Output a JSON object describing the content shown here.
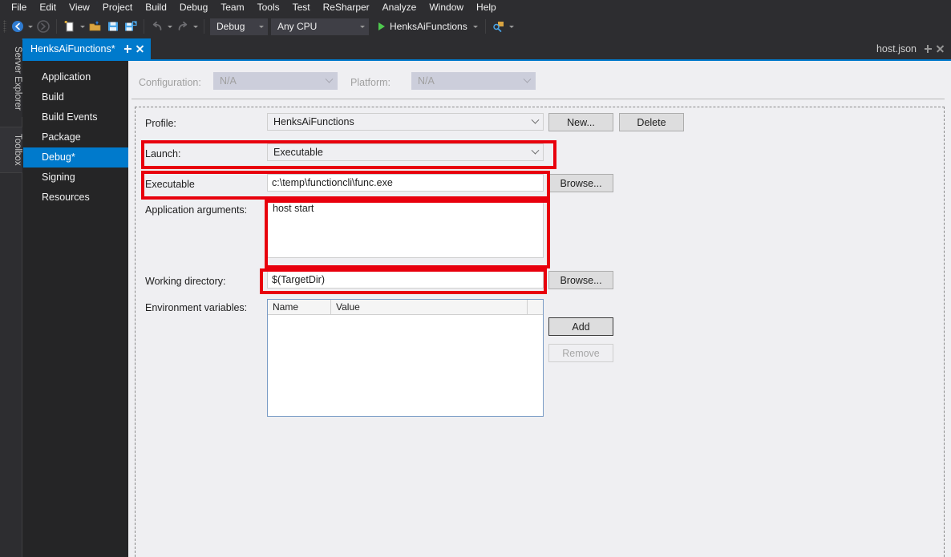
{
  "menubar": {
    "items": [
      "File",
      "Edit",
      "View",
      "Project",
      "Build",
      "Debug",
      "Team",
      "Tools",
      "Test",
      "ReSharper",
      "Analyze",
      "Window",
      "Help"
    ]
  },
  "toolbar": {
    "nav_back_icon": "navigate-back-icon",
    "nav_forward_icon": "navigate-forward-icon",
    "new_item_icon": "new-item-icon",
    "open_file_icon": "open-file-icon",
    "save_icon": "save-icon",
    "save_all_icon": "save-all-icon",
    "undo_icon": "undo-icon",
    "redo_icon": "redo-icon",
    "configuration": "Debug",
    "platform": "Any CPU",
    "start_label": "HenksAiFunctions",
    "start_icon": "play-icon",
    "attach_icon": "attach-to-process-icon"
  },
  "dockstrip": {
    "server_explorer": "Server Explorer",
    "toolbox": "Toolbox"
  },
  "tabs": {
    "active": "HenksAiFunctions*",
    "right_tab": "host.json",
    "pin_icon": "pin-icon",
    "close_icon": "close-icon"
  },
  "categories": [
    {
      "label": "Application",
      "selected": false
    },
    {
      "label": "Build",
      "selected": false
    },
    {
      "label": "Build Events",
      "selected": false
    },
    {
      "label": "Package",
      "selected": false
    },
    {
      "label": "Debug*",
      "selected": true
    },
    {
      "label": "Signing",
      "selected": false
    },
    {
      "label": "Resources",
      "selected": false
    }
  ],
  "page": {
    "configuration_label": "Configuration:",
    "configuration_value": "N/A",
    "platform_label": "Platform:",
    "platform_value": "N/A",
    "profile_label": "Profile:",
    "profile_value": "HenksAiFunctions",
    "new_button": "New...",
    "delete_button": "Delete",
    "launch_label": "Launch:",
    "launch_value": "Executable",
    "executable_label": "Executable",
    "executable_value": "c:\\temp\\functioncli\\func.exe",
    "executable_browse": "Browse...",
    "app_args_label": "Application arguments:",
    "app_args_value": "host start",
    "working_dir_label": "Working directory:",
    "working_dir_value": "$(TargetDir)",
    "working_dir_browse": "Browse...",
    "env_vars_label": "Environment variables:",
    "env_col_name": "Name",
    "env_col_value": "Value",
    "env_rows": [],
    "add_button": "Add",
    "remove_button": "Remove"
  },
  "annotations": {
    "highlight_color": "#e8000d",
    "boxes": [
      "launch-row",
      "executable-row",
      "application-arguments-row",
      "working-directory-row"
    ]
  }
}
